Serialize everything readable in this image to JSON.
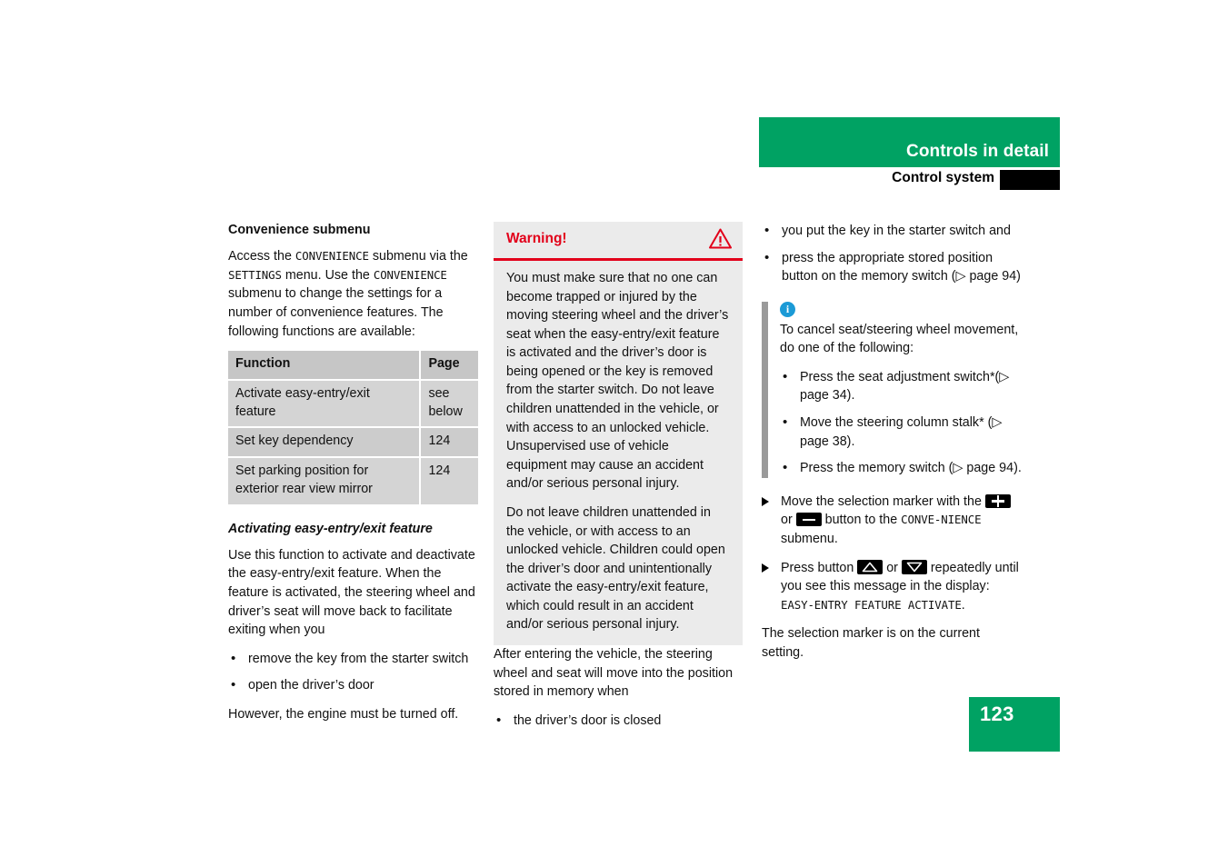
{
  "header": {
    "title": "Controls in detail",
    "subtitle": "Control system",
    "accent_color": "#00a263",
    "tab_color": "#000000"
  },
  "page_number": "123",
  "left_column": {
    "section_heading": "Convenience submenu",
    "intro_parts": {
      "p1": "Access the ",
      "mono1": "CONVENIENCE",
      "p2": " submenu via the ",
      "mono2": "SETTINGS",
      "p3": " menu. Use the ",
      "mono3": "CONVENIENCE",
      "p4": " submenu to change the settings for a number of convenience features. The following functions are available:"
    },
    "table": {
      "headers": [
        "Function",
        "Page"
      ],
      "rows": [
        [
          "Activate easy-entry/exit feature",
          "see below"
        ],
        [
          "Set key dependency",
          "124"
        ],
        [
          "Set parking position for exterior rear view mirror",
          "124"
        ]
      ]
    },
    "sub_heading": "Activating easy-entry/exit feature",
    "body": "Use this function to activate and deactivate the easy-entry/exit feature. When the feature is activated, the steering wheel and driver’s seat will move back to facilitate exiting when you",
    "bullets": [
      "remove the key from the starter switch",
      "open the driver’s door"
    ],
    "closing": "However, the engine must be turned off."
  },
  "middle_column": {
    "warning": {
      "title": "Warning!",
      "icon": "warning-triangle-icon",
      "accent_color": "#e2001a",
      "paragraphs": [
        "You must make sure that no one can become trapped or injured by the moving steering wheel and the driver’s seat when the easy-entry/exit feature is activated and the driver’s door is being opened or the key is removed from the starter switch. Do not leave children unattended in the vehicle, or with access to an unlocked vehicle. Unsupervised use of vehicle equipment may cause an accident and/or serious personal injury.",
        "Do not leave children unattended in the vehicle, or with access to an unlocked vehicle. Children could open the driver’s door and unintentionally activate the easy-entry/exit feature, which could result in an accident and/or serious personal injury."
      ]
    },
    "after_text": "After entering the vehicle, the steering wheel and seat will move into the position stored in memory when",
    "after_bullets": [
      "the driver’s door is closed"
    ]
  },
  "right_column": {
    "top_bullets": [
      "you put the key in the starter switch and",
      "press the appropriate stored position button on the memory switch (▷ page 94)"
    ],
    "info": {
      "icon": "info-circle-icon",
      "icon_color": "#1b9ad6",
      "intro": "To cancel seat/steering wheel movement, do one of the following:",
      "bullets": [
        "Press the seat adjustment switch*(▷ page 34).",
        "Move the steering column stalk* (▷ page 38).",
        "Press the memory switch (▷ page 94)."
      ]
    },
    "steps": [
      {
        "t1": "Move the selection marker with the ",
        "btn1": "plus-button",
        "t2": " or ",
        "btn2": "minus-button",
        "t3": " button to the ",
        "mono": "CONVE-NIENCE",
        "t4": " submenu."
      },
      {
        "t1": "Press button ",
        "btn1": "up-arrow-button",
        "t2": " or ",
        "btn2": "down-arrow-button",
        "t3": " repeatedly until you see this message in the display: ",
        "mono": "EASY-ENTRY FEATURE ACTIVATE",
        "t4": "."
      }
    ],
    "closing": "The selection marker is on the current setting."
  }
}
